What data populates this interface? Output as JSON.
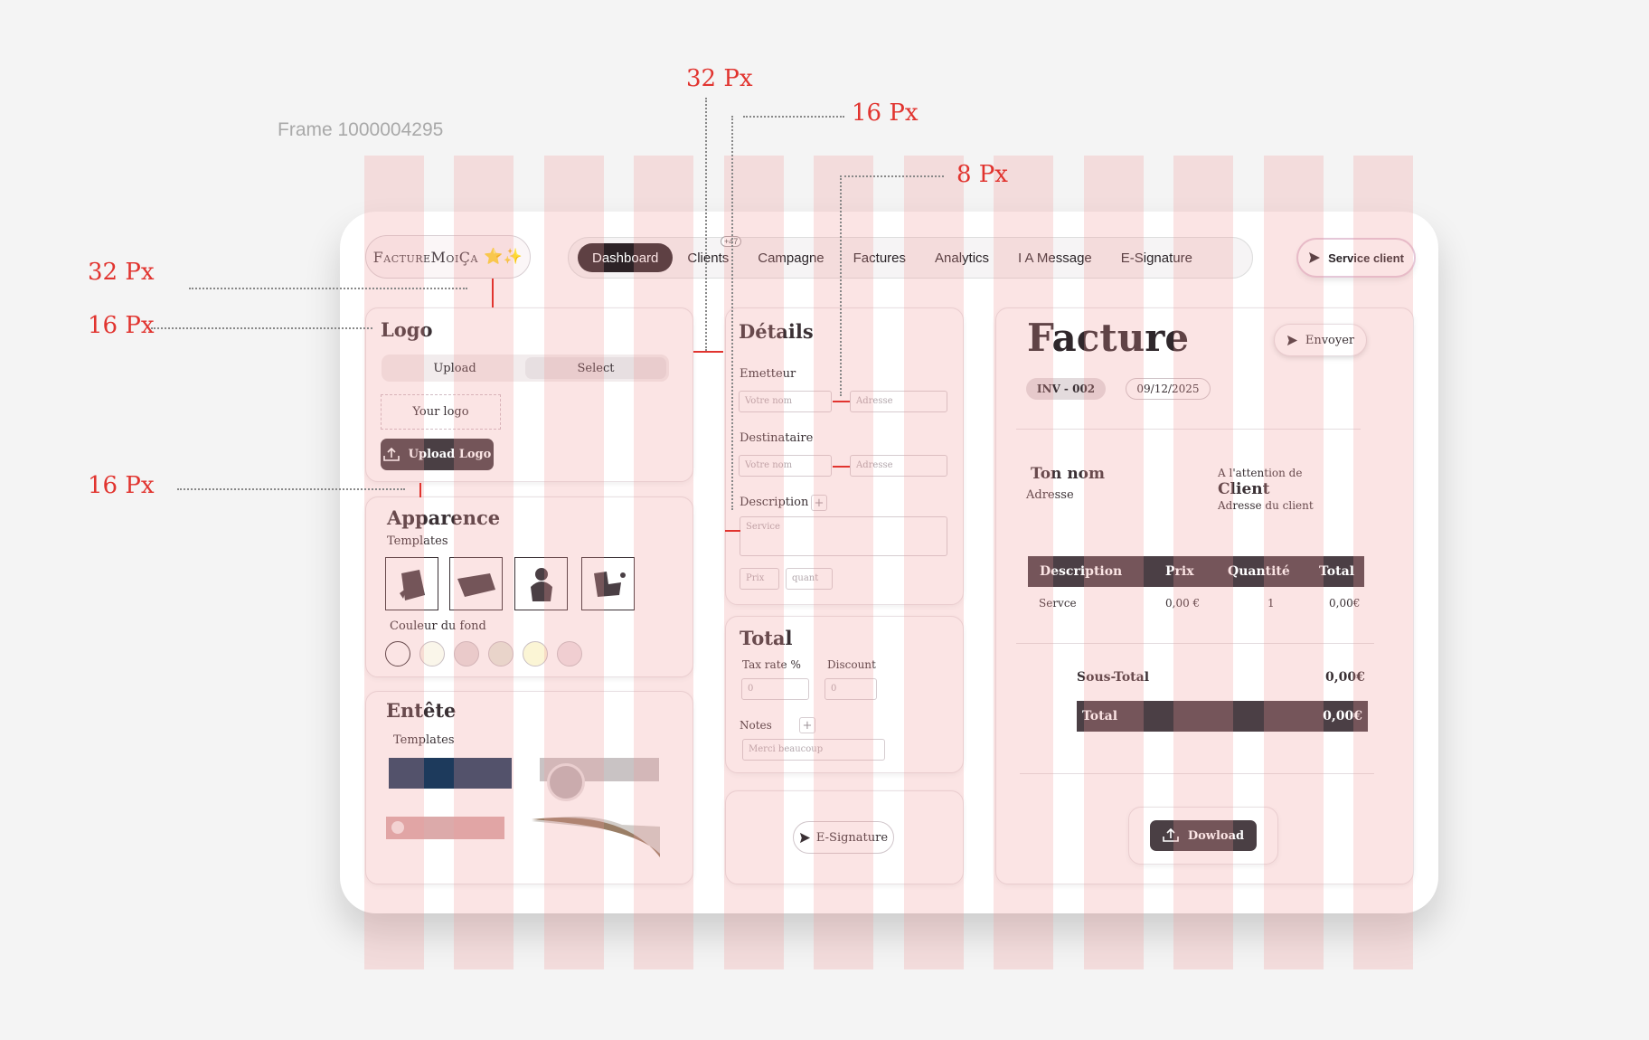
{
  "frame_label": "Frame 1000004295",
  "brand": {
    "name": "FactureMoiÇa",
    "sparkle": "⭐✨"
  },
  "nav": {
    "items": [
      {
        "label": "Dashboard",
        "active": true
      },
      {
        "label": "Clients",
        "badge": "+47"
      },
      {
        "label": "Campagne"
      },
      {
        "label": "Factures"
      },
      {
        "label": "Analytics"
      },
      {
        "label": "I A Message"
      },
      {
        "label": "E-Signature"
      }
    ]
  },
  "service_client": "Service client",
  "logo_card": {
    "title": "Logo",
    "segments": [
      "Upload",
      "Select"
    ],
    "placeholder": "Your logo",
    "upload_button": "Upload Logo"
  },
  "apparence_card": {
    "title": "Apparence",
    "templates_label": "Templates",
    "bg_label": "Couleur du fond",
    "swatches": [
      "#ffffff",
      "#faf6ea",
      "#e8dcdc",
      "#e7eadc",
      "#fbf5d5",
      "#f1e2e6"
    ]
  },
  "entete_card": {
    "title": "Entête",
    "templates_label": "Templates"
  },
  "details_card": {
    "title": "Détails",
    "emetteur": "Emetteur",
    "destinataire": "Destinataire",
    "description": "Description",
    "name_placeholder": "Votre nom",
    "address_placeholder": "Adresse",
    "service_placeholder": "Service",
    "price_placeholder": "Prix",
    "qty_placeholder": "quant"
  },
  "total_card": {
    "title": "Total",
    "tax_label": "Tax rate %",
    "discount_label": "Discount",
    "tax_value": "0",
    "discount_value": "0",
    "notes_label": "Notes",
    "notes_value": "Merci beaucoup"
  },
  "esign_button": "E-Signature",
  "invoice": {
    "title": "Facture",
    "send_button": "Envoyer",
    "number": "INV - 002",
    "date": "09/12/2025",
    "from_name": "Ton nom",
    "from_address": "Adresse",
    "to_attention": "A l'attention de",
    "to_name": "Client",
    "to_address": "Adresse du client",
    "columns": [
      "Description",
      "Prix",
      "Quantité",
      "Total"
    ],
    "rows": [
      {
        "description": "Servce",
        "price": "0,00 €",
        "qty": "1",
        "total": "0,00€"
      }
    ],
    "subtotal_label": "Sous-Total",
    "subtotal_value": "0,00€",
    "total_label": "Total",
    "total_value": "0,00€",
    "download_button": "Dowload"
  },
  "annotations": {
    "a32_top": "32 Px",
    "a16_top": "16 Px",
    "a8": "8 Px",
    "a32_left": "32 Px",
    "a16_left": "16 Px",
    "a16_left2": "16 Px"
  }
}
